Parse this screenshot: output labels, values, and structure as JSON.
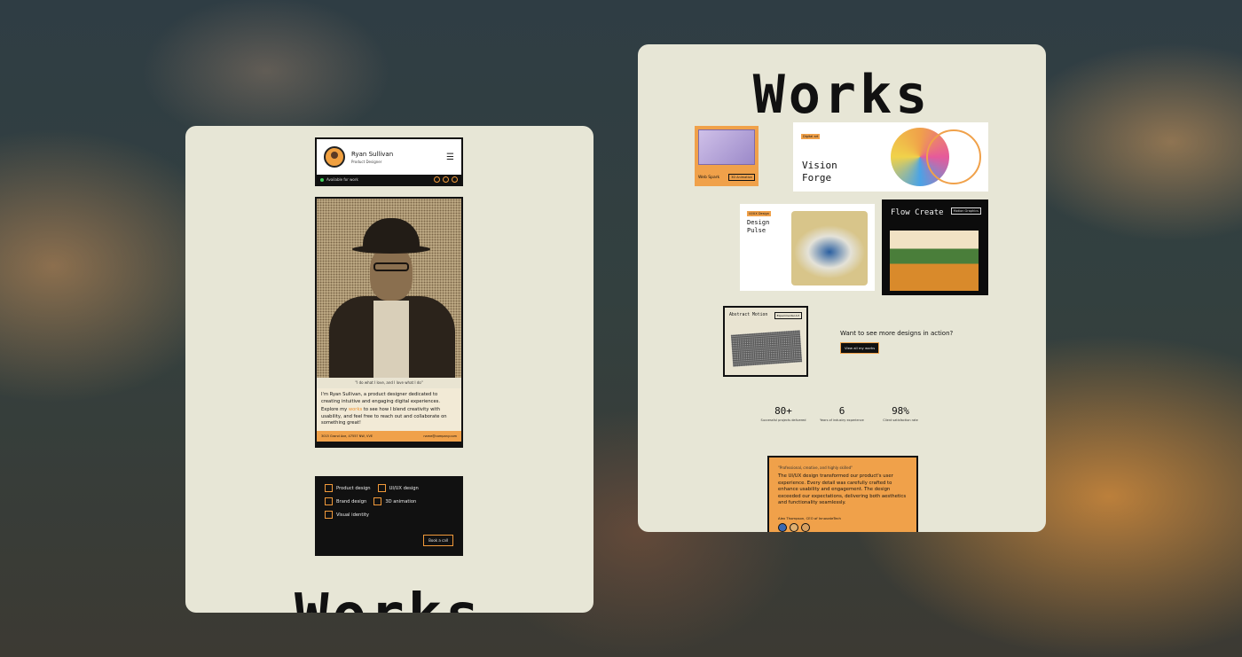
{
  "profile": {
    "name": "Ryan Sullivan",
    "role": "Product Designer",
    "availability": "Available for work",
    "quote": "\"I do what I love, and I love what I do\"",
    "bio_1": "I'm Ryan Sullivan, a product designer dedicated to creating intuitive and engaging digital experiences.",
    "bio_2a": "Explore my ",
    "bio_link": "works",
    "bio_2b": " to see how I blend creativity with usability, and feel free to reach out and collaborate on something great!",
    "address": "3015 Grand Ave, 47557 NW, VVE",
    "email": "name@company.com"
  },
  "services": {
    "items": [
      "Product design",
      "UI/UX design",
      "Brand design",
      "3D animation",
      "Visual identity"
    ],
    "cta": "Book a call"
  },
  "left_footer_title": "Works",
  "works": {
    "title": "Works",
    "projects": [
      {
        "name": "Web Spark",
        "tag": "3D Animation"
      },
      {
        "name": "Vision Forge",
        "tag": "Digital art"
      },
      {
        "name": "Design Pulse",
        "tag": "UI/UX Design"
      },
      {
        "name": "Flow Create",
        "tag": "Motion Graphics"
      },
      {
        "name": "Abstract Motion",
        "tag": "Experimental Art"
      }
    ],
    "cta_text": "Want to see more designs in action?",
    "cta_button": "View all my works"
  },
  "stats": [
    {
      "value": "80+",
      "label": "Successful projects delivered"
    },
    {
      "value": "6",
      "label": "Years of industry experience"
    },
    {
      "value": "98%",
      "label": "Client satisfaction rate"
    }
  ],
  "testimonial": {
    "headline": "\"Professional, creative, and highly skilled\"",
    "text": "The UI/UX design transformed our product's user experience. Every detail was carefully crafted to enhance usability and engagement. The design exceeded our expectations, delivering both aesthetics and functionality seamlessly.",
    "author": "Alex Thompson, CEO of InnovateTech"
  }
}
